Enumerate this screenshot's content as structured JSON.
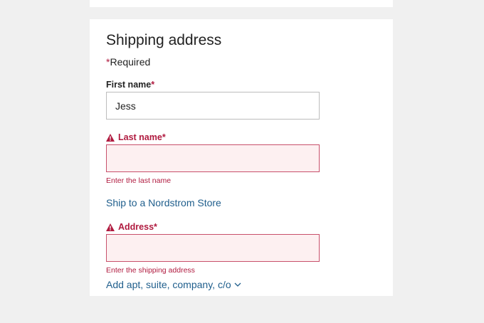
{
  "form": {
    "title": "Shipping address",
    "required_marker": "*",
    "required_note": "Required",
    "first_name": {
      "label": "First name",
      "value": "Jess"
    },
    "last_name": {
      "label": "Last name",
      "value": "",
      "error": "Enter the last name"
    },
    "ship_to_store_link": "Ship to a Nordstrom Store",
    "address": {
      "label": "Address",
      "value": "",
      "error": "Enter the shipping address"
    },
    "add_apt_link": "Add apt, suite, company, c/o"
  },
  "colors": {
    "error": "#b01a3f",
    "error_fill": "#fdf0f1",
    "link": "#1f5e8c",
    "page_bg": "#f0f0f0"
  },
  "icons": {
    "warning": "warning-triangle-icon",
    "chevron": "chevron-down-icon"
  }
}
